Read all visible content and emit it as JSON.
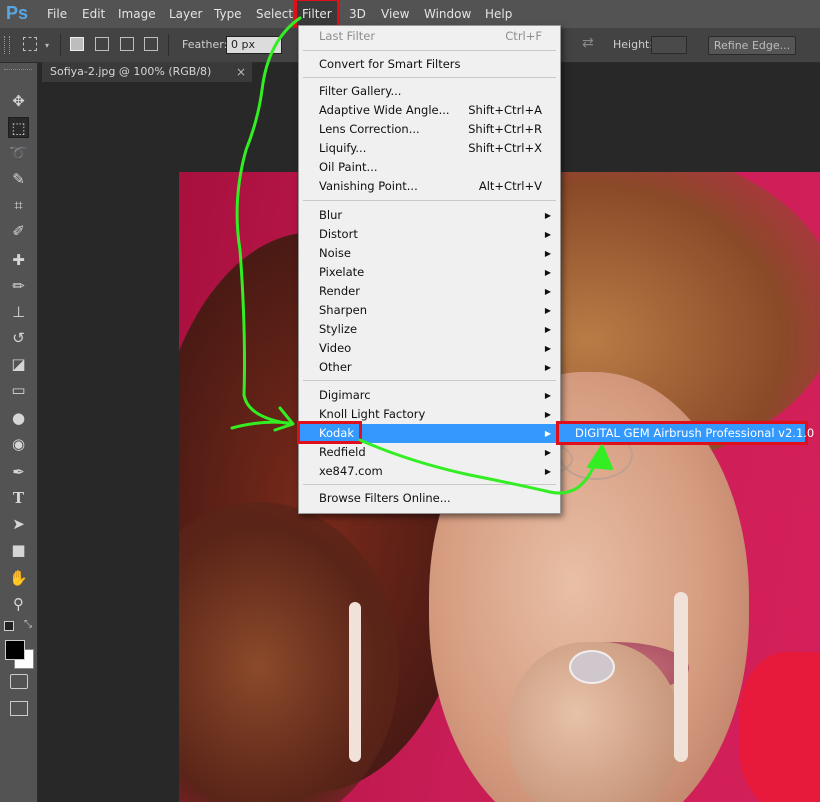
{
  "app": {
    "logo": "Ps"
  },
  "menubar": {
    "items": [
      "File",
      "Edit",
      "Image",
      "Layer",
      "Type",
      "Select",
      "Filter",
      "3D",
      "View",
      "Window",
      "Help"
    ],
    "active": "Filter"
  },
  "options": {
    "feather_label": "Feather:",
    "feather_value": "0 px",
    "height_label": "Height:",
    "refine_edge_label": "Refine Edge..."
  },
  "document": {
    "tab_title": "Sofiya-2.jpg @ 100% (RGB/8)",
    "close_glyph": "×"
  },
  "filter_menu": {
    "groups": [
      [
        {
          "label": "Last Filter",
          "shortcut": "Ctrl+F",
          "disabled": true
        }
      ],
      [
        {
          "label": "Convert for Smart Filters",
          "shortcut": ""
        }
      ],
      [
        {
          "label": "Filter Gallery...",
          "shortcut": ""
        },
        {
          "label": "Adaptive Wide Angle...",
          "shortcut": "Shift+Ctrl+A"
        },
        {
          "label": "Lens Correction...",
          "shortcut": "Shift+Ctrl+R"
        },
        {
          "label": "Liquify...",
          "shortcut": "Shift+Ctrl+X"
        },
        {
          "label": "Oil Paint...",
          "shortcut": ""
        },
        {
          "label": "Vanishing Point...",
          "shortcut": "Alt+Ctrl+V"
        }
      ],
      [
        {
          "label": "Blur",
          "submenu": true
        },
        {
          "label": "Distort",
          "submenu": true
        },
        {
          "label": "Noise",
          "submenu": true
        },
        {
          "label": "Pixelate",
          "submenu": true
        },
        {
          "label": "Render",
          "submenu": true
        },
        {
          "label": "Sharpen",
          "submenu": true
        },
        {
          "label": "Stylize",
          "submenu": true
        },
        {
          "label": "Video",
          "submenu": true
        },
        {
          "label": "Other",
          "submenu": true
        }
      ],
      [
        {
          "label": "Digimarc",
          "submenu": true
        },
        {
          "label": "Knoll Light Factory",
          "submenu": true
        },
        {
          "label": "Kodak",
          "submenu": true,
          "highlighted": true
        },
        {
          "label": "Redfield",
          "submenu": true
        },
        {
          "label": "xe847.com",
          "submenu": true
        }
      ],
      [
        {
          "label": "Browse Filters Online...",
          "shortcut": ""
        }
      ]
    ]
  },
  "kodak_submenu": {
    "items": [
      "DIGITAL GEM Airbrush Professional v2.1.0"
    ]
  },
  "toolbox": {
    "tools": [
      "move-tool",
      "marquee-tool",
      "lasso-tool",
      "quick-selection-tool",
      "crop-tool",
      "eyedropper-tool",
      "healing-brush-tool",
      "brush-tool",
      "clone-stamp-tool",
      "history-brush-tool",
      "eraser-tool",
      "gradient-tool",
      "blur-tool",
      "dodge-tool",
      "pen-tool",
      "type-tool",
      "path-selection-tool",
      "rectangle-tool",
      "hand-tool",
      "zoom-tool",
      "default-colors-icon",
      "swap-colors-icon",
      "foreground-color",
      "background-color",
      "quick-mask-icon",
      "screen-mode-icon"
    ],
    "type_tool_glyph": "T"
  },
  "colors": {
    "foreground": "#000000",
    "background": "#ffffff",
    "annotation_red": "#e0101a",
    "annotation_green": "#33ee22",
    "menu_highlight": "#3399ff"
  }
}
